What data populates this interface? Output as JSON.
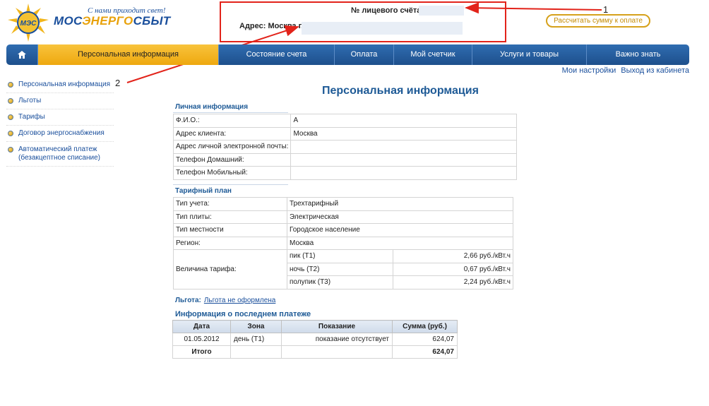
{
  "header": {
    "slogan": "С нами приходит свет!",
    "brand_part1": "МОС",
    "brand_part2": "ЭНЕРГО",
    "brand_part3": "СБЫТ",
    "logo_badge": "МЭС",
    "account_number_label": "№ лицевого счёта:",
    "address_label": "Адрес: Москва г.,",
    "calc_button": "Рассчитать сумму к оплате"
  },
  "annotations": [
    "1",
    "2"
  ],
  "nav": {
    "items": [
      {
        "label": "",
        "icon": "home-icon"
      },
      {
        "label": "Персональная информация",
        "active": true
      },
      {
        "label": "Состояние счета"
      },
      {
        "label": "Оплата"
      },
      {
        "label": "Мой счетчик"
      },
      {
        "label": "Услуги и товары"
      },
      {
        "label": "Важно знать"
      }
    ]
  },
  "toplinks": {
    "settings": "Мои настройки",
    "logout": "Выход из кабинета"
  },
  "sidebar": {
    "items": [
      {
        "label": "Персональная информация"
      },
      {
        "label": "Льготы"
      },
      {
        "label": "Тарифы"
      },
      {
        "label": "Договор энергоснабжения"
      },
      {
        "label": "Автоматический платеж (безакцептное списание)"
      }
    ]
  },
  "main": {
    "title": "Персональная информация",
    "personal": {
      "section_title": "Личная информация",
      "rows": [
        {
          "key": "Ф.И.О.:",
          "value": "А"
        },
        {
          "key": "Адрес клиента:",
          "value": "Москва"
        },
        {
          "key": "Адрес личной электронной почты:",
          "value": ""
        },
        {
          "key": "Телефон Домашний:",
          "value": ""
        },
        {
          "key": "Телефон Мобильный:",
          "value": ""
        }
      ]
    },
    "tariff": {
      "section_title": "Тарифный план",
      "rows": [
        {
          "key": "Тип учета:",
          "value": "Трехтарифный"
        },
        {
          "key": "Тип плиты:",
          "value": "Электрическая"
        },
        {
          "key": "Тип местности",
          "value": "Городское население"
        },
        {
          "key": "Регион:",
          "value": "Москва"
        }
      ],
      "rate_label": "Величина тарифа:",
      "rates": [
        {
          "zone": "пик (Т1)",
          "price": "2,66 руб./кВт.ч"
        },
        {
          "zone": "ночь (Т2)",
          "price": "0,67 руб./кВт.ч"
        },
        {
          "zone": "полупик (Т3)",
          "price": "2,24 руб./кВт.ч"
        }
      ]
    },
    "benefit": {
      "label": "Льгота:",
      "link": "Льгота не оформлена"
    },
    "last_payment": {
      "title": "Информация о последнем платеже",
      "headers": [
        "Дата",
        "Зона",
        "Показание",
        "Сумма (руб.)"
      ],
      "rows": [
        [
          "01.05.2012",
          "день (Т1)",
          "показание отсутствует",
          "624,07"
        ]
      ],
      "total": [
        "Итого",
        "",
        "",
        "624,07"
      ]
    }
  }
}
